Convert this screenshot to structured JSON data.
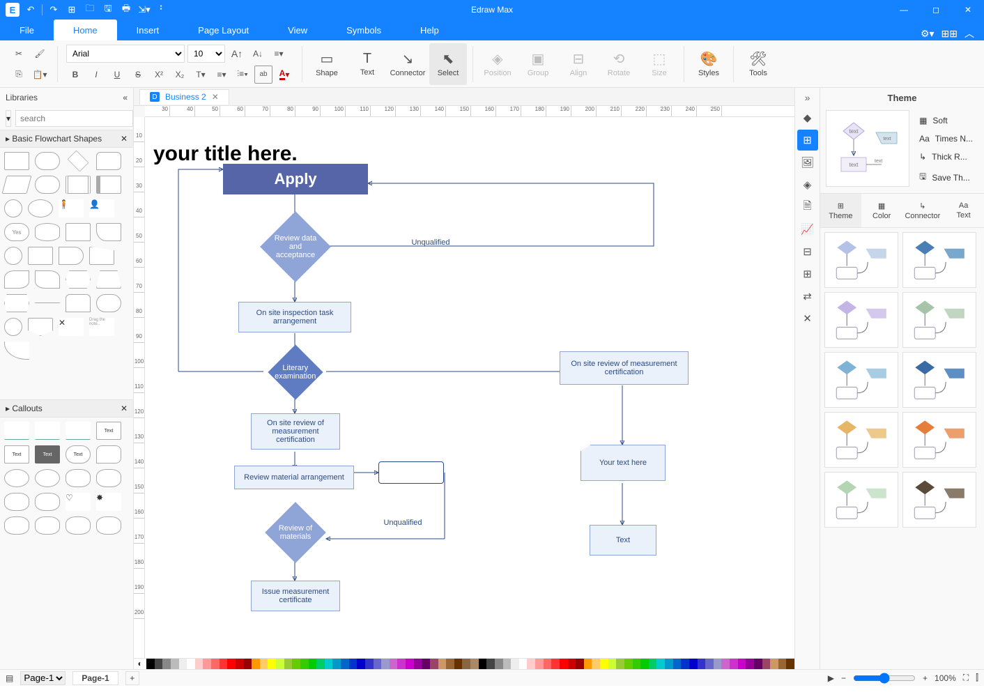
{
  "app_name": "Edraw Max",
  "menu": {
    "file": "File",
    "home": "Home",
    "insert": "Insert",
    "pagelayout": "Page Layout",
    "view": "View",
    "symbols": "Symbols",
    "help": "Help"
  },
  "ribbon": {
    "font_family": "Arial",
    "font_size": "10",
    "shape": "Shape",
    "text": "Text",
    "connector": "Connector",
    "select": "Select",
    "position": "Position",
    "group": "Group",
    "align": "Align",
    "rotate": "Rotate",
    "size": "Size",
    "styles": "Styles",
    "tools": "Tools"
  },
  "libraries": {
    "title": "Libraries",
    "search_placeholder": "search",
    "cat1": "Basic Flowchart Shapes",
    "cat2": "Callouts"
  },
  "doctab": {
    "name": "Business 2"
  },
  "canvas": {
    "title": "your title here.",
    "apply": "Apply",
    "review_data": "Review data and acceptance",
    "unqualified": "Unqualified",
    "onsite_task": "On site inspection task arrangement",
    "literary": "Literary examination",
    "onsite_review": "On site review of measurement certification",
    "onsite_review2": "On site review of measurement certification",
    "review_mat_arr": "Review material arrangement",
    "review_mat": "Review of materials",
    "unqualified2": "Unqualified",
    "issue_cert": "Issue measurement certificate",
    "your_text": "Your text here",
    "text": "Text"
  },
  "theme": {
    "title": "Theme",
    "soft": "Soft",
    "times": "Times N...",
    "thick": "Thick R...",
    "save": "Save Th...",
    "modes": {
      "theme": "Theme",
      "color": "Color",
      "connector": "Connector",
      "text": "Text"
    }
  },
  "status": {
    "page_select": "Page-1",
    "page_tab": "Page-1",
    "zoom": "100%"
  },
  "ruler_h": [
    30,
    40,
    50,
    60,
    70,
    80,
    90,
    100,
    110,
    120,
    130,
    140,
    150,
    160,
    170,
    180,
    190,
    200,
    210,
    220,
    230,
    240,
    250
  ],
  "ruler_v": [
    10,
    20,
    30,
    40,
    50,
    60,
    70,
    80,
    90,
    100,
    110,
    120,
    130,
    140,
    150,
    160,
    170,
    180,
    190,
    200
  ],
  "swatches": [
    "#000",
    "#444",
    "#888",
    "#bbb",
    "#eee",
    "#fff",
    "#fcc",
    "#f99",
    "#f66",
    "#f33",
    "#f00",
    "#c00",
    "#900",
    "#f90",
    "#fc6",
    "#ff0",
    "#cf3",
    "#9c3",
    "#6c0",
    "#3c0",
    "#0c0",
    "#0c6",
    "#0cc",
    "#09c",
    "#06c",
    "#03c",
    "#00c",
    "#33c",
    "#66c",
    "#99c",
    "#c6c",
    "#c3c",
    "#c0c",
    "#909",
    "#606",
    "#946",
    "#c96",
    "#963",
    "#630",
    "#864",
    "#a86"
  ],
  "theme_colors": [
    [
      "#b3c2e6",
      "#c5d5ea",
      "#d9e3f2"
    ],
    [
      "#4a7fb5",
      "#7aa8cc",
      "#b3ccdf"
    ],
    [
      "#c4b5e6",
      "#d4c9ec",
      "#e3dcf3"
    ],
    [
      "#a8c4a8",
      "#c0d6c0",
      "#d8e8d8"
    ],
    [
      "#7fb3d5",
      "#a8cce3",
      "#cce0ef"
    ],
    [
      "#3b6ba5",
      "#5e8fc4",
      "#91b6db"
    ],
    [
      "#e6b566",
      "#edc98c",
      "#f3ddb3"
    ],
    [
      "#e67e3b",
      "#ec9e6c",
      "#f2bf9e"
    ],
    [
      "#b3d5b3",
      "#cce3cc",
      "#e0efe0"
    ],
    [
      "#5a4a3a",
      "#8a7a6a",
      "#baa99a"
    ]
  ]
}
